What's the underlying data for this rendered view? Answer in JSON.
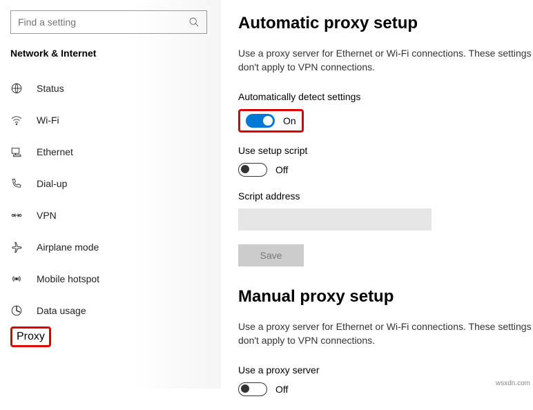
{
  "search": {
    "placeholder": "Find a setting"
  },
  "category": "Network & Internet",
  "nav": [
    {
      "label": "Status"
    },
    {
      "label": "Wi-Fi"
    },
    {
      "label": "Ethernet"
    },
    {
      "label": "Dial-up"
    },
    {
      "label": "VPN"
    },
    {
      "label": "Airplane mode"
    },
    {
      "label": "Mobile hotspot"
    },
    {
      "label": "Data usage"
    },
    {
      "label": "Proxy"
    }
  ],
  "auto": {
    "title": "Automatic proxy setup",
    "desc": "Use a proxy server for Ethernet or Wi-Fi connections. These settings don't apply to VPN connections.",
    "detect_label": "Automatically detect settings",
    "detect_state": "On",
    "script_label": "Use setup script",
    "script_state": "Off",
    "script_address_label": "Script address",
    "script_address_value": "",
    "save": "Save"
  },
  "manual": {
    "title": "Manual proxy setup",
    "desc": "Use a proxy server for Ethernet or Wi-Fi connections. These settings don't apply to VPN connections.",
    "use_label": "Use a proxy server",
    "use_state": "Off"
  },
  "watermark": "wsxdn.com"
}
